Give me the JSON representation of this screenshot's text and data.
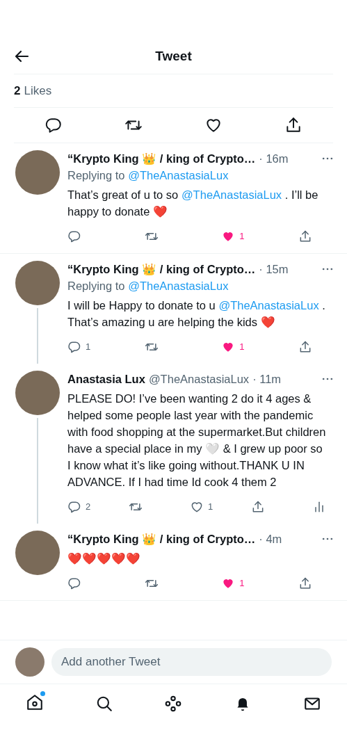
{
  "header": {
    "title": "Tweet"
  },
  "likes": {
    "count": "2",
    "label": "Likes"
  },
  "replies": [
    {
      "name": "“Krypto King 👑 / king of Crypto…",
      "time": "· 16m",
      "replying_to": {
        "label": "Replying to",
        "mention": "@TheAnastasiaLux"
      },
      "thread_below": false,
      "segments": [
        {
          "kind": "plain",
          "text": "That’s great of u to so "
        },
        {
          "kind": "mention",
          "text": "@TheAnastasiaLux"
        },
        {
          "kind": "plain",
          "text": " . I’ll be happy to donate ❤️"
        }
      ],
      "like_count": "1",
      "liked": true,
      "analytics": false
    },
    {
      "name": "“Krypto King 👑 / king of Crypto…",
      "time": "· 15m",
      "replying_to": {
        "label": "Replying to",
        "mention": "@TheAnastasiaLux"
      },
      "thread_below": true,
      "segments": [
        {
          "kind": "plain",
          "text": "I will be Happy to donate to u "
        },
        {
          "kind": "mention",
          "text": "@TheAnastasiaLux"
        },
        {
          "kind": "plain",
          "text": " .  That’s amazing u are helping the kids ❤️"
        }
      ],
      "reply_count": "1",
      "like_count": "1",
      "liked": true,
      "analytics": false
    },
    {
      "name": "Anastasia Lux",
      "handle": "@TheAnastasiaLux",
      "time": "· 11m",
      "thread_below": true,
      "segments": [
        {
          "kind": "plain",
          "text": "PLEASE DO! I’ve been wanting 2 do it 4 ages & helped some people last year with the pandemic with food shopping at the supermarket.But children have a special place in my 🤍 & I grew up poor so I know what it’s like going without.THANK U IN ADVANCE. If I had time Id cook 4 them 2"
        }
      ],
      "reply_count": "2",
      "like_count": "1",
      "liked": false,
      "analytics": true
    },
    {
      "name": "“Krypto King 👑 / king of Crypto…",
      "time": "· 4m",
      "thread_below": false,
      "segments": [
        {
          "kind": "plain",
          "text": "❤️❤️❤️❤️❤️"
        }
      ],
      "like_count": "1",
      "liked": true,
      "analytics": false
    }
  ],
  "compose": {
    "placeholder": "Add another Tweet"
  },
  "nav": {
    "home_badge": true
  }
}
